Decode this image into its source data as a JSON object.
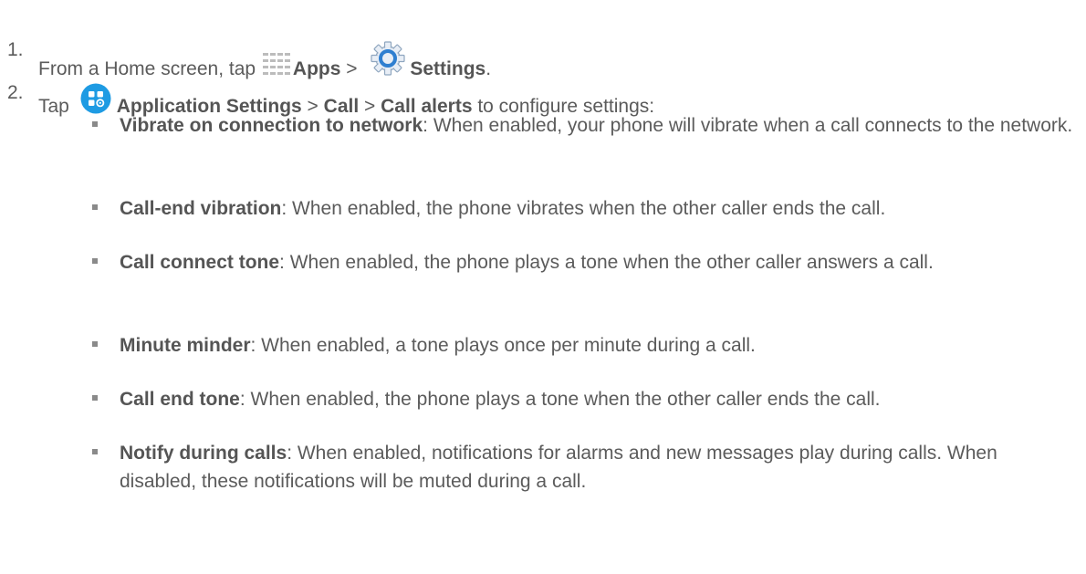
{
  "steps": [
    {
      "number": "1.",
      "prefix": "From a Home screen, tap ",
      "apps_label": "Apps",
      "sep": " > ",
      "settings_label": "Settings",
      "suffix": "."
    },
    {
      "number": "2.",
      "prefix": "Tap ",
      "app_settings_label": "Application Settings",
      "sep1": " > ",
      "call_label": "Call",
      "sep2": " > ",
      "call_alerts_label": "Call alerts",
      "suffix": " to configure settings:"
    }
  ],
  "bullets": [
    {
      "term": "Vibrate on connection to network",
      "desc": ": When enabled, your phone will vibrate when a call connects to the network."
    },
    {
      "term": "Call-end vibration",
      "desc": ": When enabled, the phone vibrates when the other caller ends the call."
    },
    {
      "term": "Call connect tone",
      "desc": ": When enabled, the phone plays a tone when the other caller answers a call."
    },
    {
      "term": "Minute minder",
      "desc": ": When enabled, a tone plays once per minute during a call."
    },
    {
      "term": "Call end tone",
      "desc": ": When enabled, the phone plays a tone when the other caller ends the call."
    },
    {
      "term": "Notify during calls",
      "desc": ": When enabled, notifications for alarms and new messages play during calls. When disabled, these notifications will be muted during a call."
    }
  ],
  "icons": {
    "apps": "apps-grid-icon",
    "settings": "settings-gear-icon",
    "application_settings": "application-settings-icon"
  },
  "colors": {
    "text": "#5b5b5b",
    "accent_blue": "#1e9be3",
    "gear_blue": "#3a8ed8",
    "bullet": "#8a8a8a"
  }
}
